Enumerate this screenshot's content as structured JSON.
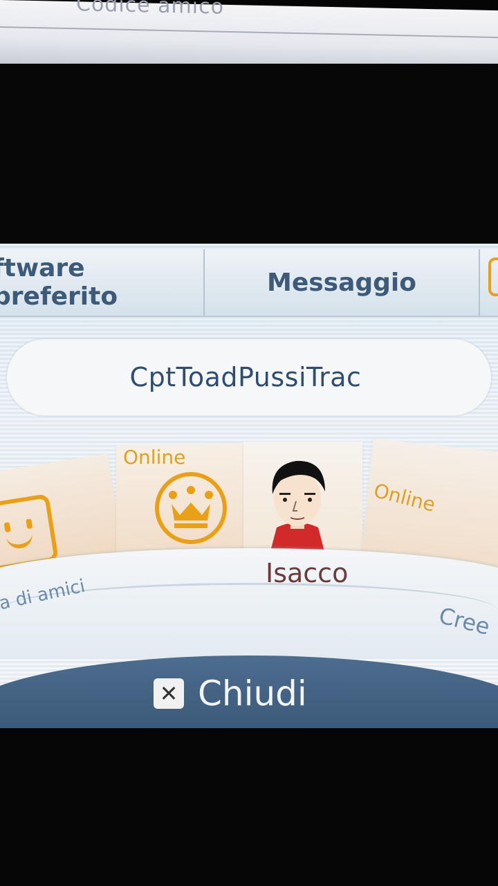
{
  "upper_screen": {
    "partial_text": "Codice amico"
  },
  "tabs": [
    {
      "label": "ftware preferito"
    },
    {
      "label": "Messaggio"
    }
  ],
  "profile": {
    "name": "CptToadPussiTrac"
  },
  "carousel": {
    "left_caption": "a di amici",
    "items": [
      {
        "status": "Online",
        "icon": "crown-icon"
      },
      {
        "name": "Isacco",
        "icon": "mii-avatar"
      },
      {
        "status": "Online"
      }
    ],
    "right_caption": "Cree"
  },
  "footer": {
    "close_label": "Chiudi",
    "close_icon": "x-button-icon"
  },
  "colors": {
    "accent_orange": "#e9a017",
    "tab_text": "#3d5a78",
    "footer_bar": "#3c5a7a"
  }
}
